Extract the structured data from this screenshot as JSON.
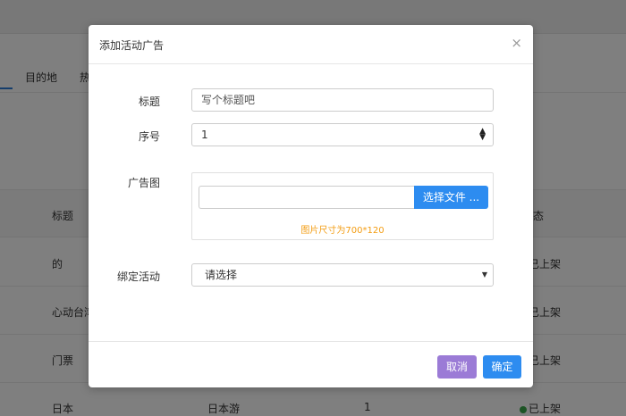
{
  "background": {
    "tabs": [
      "目的地",
      "热"
    ],
    "table": {
      "header_title": "标题",
      "header_status_fragment": "态",
      "rows": [
        {
          "title": "的",
          "name": "",
          "num": "",
          "status": "已上架"
        },
        {
          "title": "心动台湾",
          "name": "",
          "num": "",
          "status": "已上架"
        },
        {
          "title": "门票",
          "name": "",
          "num": "",
          "status": "已上架"
        },
        {
          "title": "日本",
          "name": "日本游",
          "num": "1",
          "status": "已上架"
        }
      ]
    },
    "colors": {
      "status_dot": "#3aa84a",
      "tab_underline": "#2b7bd6"
    }
  },
  "modal": {
    "title": "添加活动广告",
    "close_icon": "close-icon",
    "fields": {
      "title_label": "标题",
      "title_placeholder": "写个标题吧",
      "order_label": "序号",
      "order_value": "1",
      "image_label": "广告图",
      "file_button": "选择文件 ...",
      "image_hint": "图片尺寸为700*120",
      "activity_label": "绑定活动",
      "activity_selected": "请选择"
    },
    "buttons": {
      "cancel": "取消",
      "confirm": "确定"
    },
    "colors": {
      "primary": "#2d8cf0",
      "cancel": "#9b7bd6",
      "hint": "#f39c12"
    }
  }
}
